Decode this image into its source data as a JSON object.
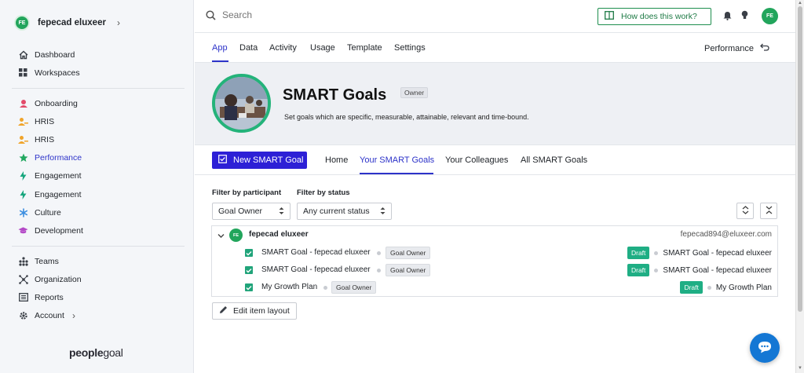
{
  "user": {
    "initials": "FE",
    "name": "fepecad eluxeer"
  },
  "nav_primary": [
    {
      "label": "Dashboard",
      "icon": "home-icon"
    },
    {
      "label": "Workspaces",
      "icon": "grid-icon"
    }
  ],
  "nav_modules": [
    {
      "label": "Onboarding",
      "icon": "onboarding-icon",
      "color": "#e24b6a"
    },
    {
      "label": "HRIS",
      "icon": "person-icon",
      "color": "#f0a42a"
    },
    {
      "label": "HRIS",
      "icon": "person-icon",
      "color": "#f0a42a"
    },
    {
      "label": "Performance",
      "icon": "star-icon",
      "color": "#23a860",
      "active": true
    },
    {
      "label": "Engagement",
      "icon": "bolt-icon",
      "color": "#17a67e"
    },
    {
      "label": "Engagement",
      "icon": "bolt-icon",
      "color": "#17a67e"
    },
    {
      "label": "Culture",
      "icon": "asterisk-icon",
      "color": "#3b8ee0"
    },
    {
      "label": "Development",
      "icon": "graduation-cap-icon",
      "color": "#b44ac7"
    }
  ],
  "nav_admin": [
    {
      "label": "Teams",
      "icon": "teams-icon"
    },
    {
      "label": "Organization",
      "icon": "organization-icon"
    },
    {
      "label": "Reports",
      "icon": "reports-icon"
    },
    {
      "label": "Account",
      "icon": "gear-icon"
    }
  ],
  "logo": {
    "part1": "people",
    "part2": "goal"
  },
  "topbar": {
    "search_placeholder": "Search",
    "how_label": "How does this work?",
    "avatar": "FE"
  },
  "tabs": [
    "App",
    "Data",
    "Activity",
    "Usage",
    "Template",
    "Settings"
  ],
  "perf_link": "Performance",
  "hero": {
    "title": "SMART Goals",
    "badge": "Owner",
    "description": "Set goals which are specific, measurable, attainable, relevant and time-bound."
  },
  "subbar": {
    "new_button": "New SMART Goal",
    "tabs": [
      "Home",
      "Your SMART Goals",
      "Your Colleagues",
      "All SMART Goals"
    ]
  },
  "filters": {
    "participant_label": "Filter by participant",
    "participant_value": "Goal Owner",
    "status_label": "Filter by status",
    "status_value": "Any current status"
  },
  "group": {
    "initials": "FE",
    "name": "fepecad eluxeer",
    "email": "fepecad894@eluxeer.com"
  },
  "items": [
    {
      "title": "SMART Goal - fepecad eluxeer",
      "role": "Goal Owner",
      "status": "Draft",
      "right_title": "SMART Goal - fepecad eluxeer"
    },
    {
      "title": "SMART Goal - fepecad eluxeer",
      "role": "Goal Owner",
      "status": "Draft",
      "right_title": "SMART Goal - fepecad eluxeer"
    },
    {
      "title": "My Growth Plan",
      "role": "Goal Owner",
      "status": "Draft",
      "right_title": "My Growth Plan"
    }
  ],
  "edit_layout": "Edit item layout",
  "colors": {
    "accent": "#2d33c9",
    "primary_button": "#2d20d6",
    "success": "#1fae84",
    "chat": "#1477d4"
  }
}
